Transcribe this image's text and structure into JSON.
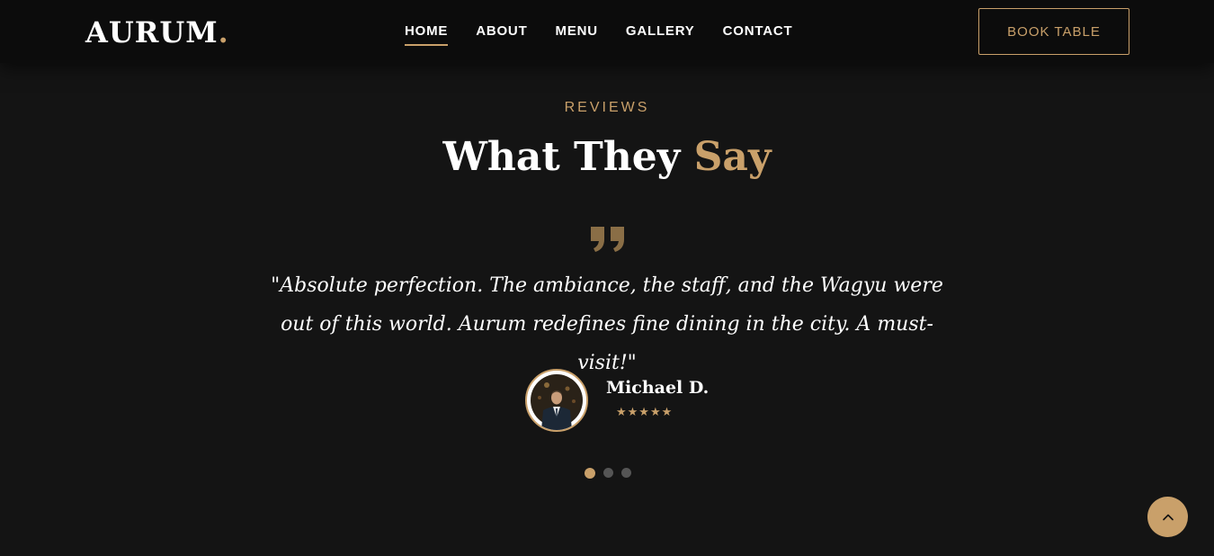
{
  "header": {
    "logo_text": "AURUM",
    "logo_dot": ".",
    "nav": [
      {
        "label": "HOME",
        "active": true
      },
      {
        "label": "ABOUT",
        "active": false
      },
      {
        "label": "MENU",
        "active": false
      },
      {
        "label": "GALLERY",
        "active": false
      },
      {
        "label": "CONTACT",
        "active": false
      }
    ],
    "book_label": "BOOK TABLE"
  },
  "reviews": {
    "eyebrow": "REVIEWS",
    "title_main": "What They",
    "title_accent": "Say",
    "quote_icon": "quote-icon",
    "quote": "\"Absolute perfection. The ambiance, the staff, and the Wagyu were out of this world. Aurum redefines fine dining in the city. A must-visit!\"",
    "author_name": "Michael D.",
    "rating_stars": 5,
    "rating_text": "★★★★★",
    "slides": {
      "count": 3,
      "active_index": 0
    }
  },
  "scroll_top_icon": "chevron-up-icon",
  "colors": {
    "accent": "#c9a06a",
    "background": "#141414",
    "header": "#0c0c0c",
    "text": "#ffffff",
    "inactive_dot": "#555555"
  }
}
